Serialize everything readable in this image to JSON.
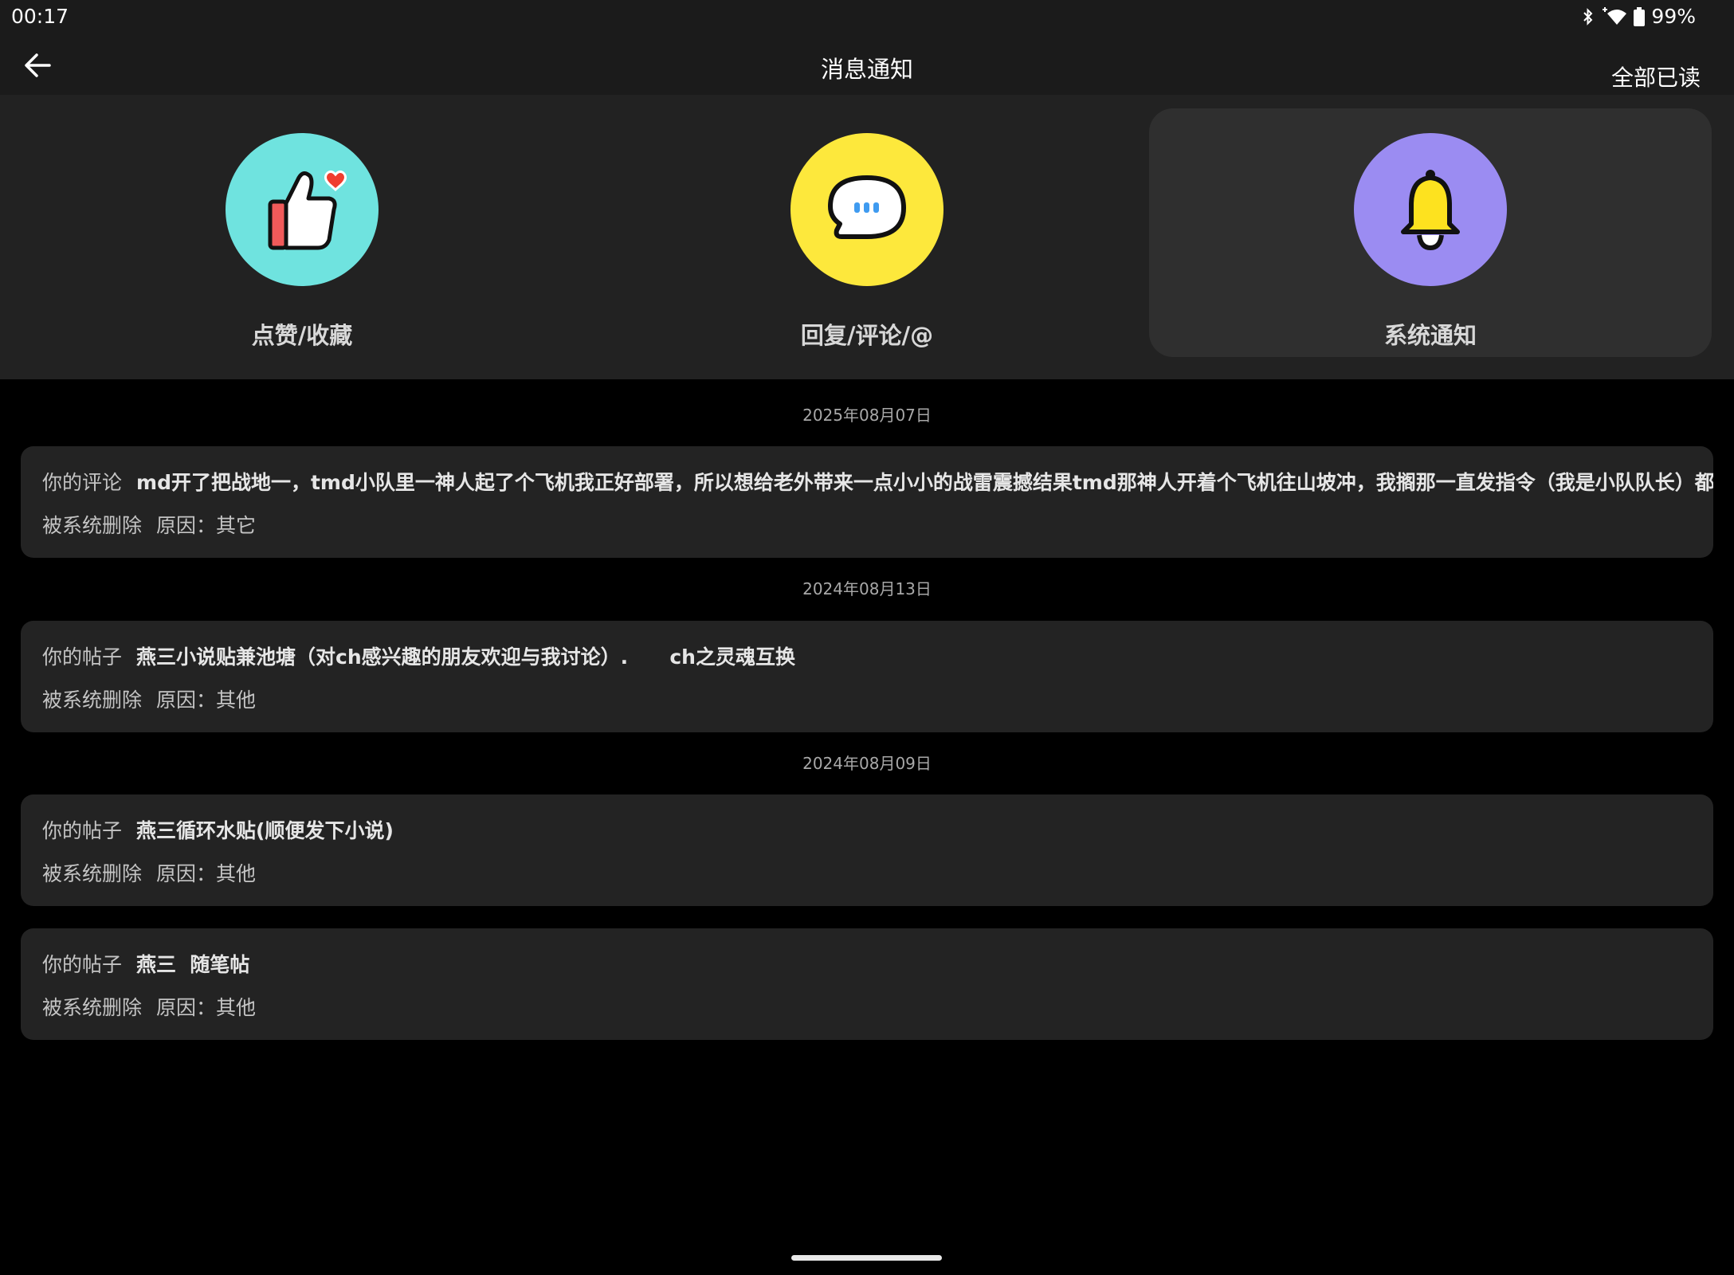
{
  "status": {
    "time": "00:17",
    "battery": "99%"
  },
  "header": {
    "title": "消息通知",
    "mark_all_read": "全部已读"
  },
  "categories": [
    {
      "label": "点赞/收藏",
      "icon": "thumbs-up-heart-icon",
      "color": "#6fe3df"
    },
    {
      "label": "回复/评论/@",
      "icon": "chat-bubble-icon",
      "color": "#fde83c"
    },
    {
      "label": "系统通知",
      "icon": "bell-icon",
      "color": "#9b8cf2",
      "active": true
    }
  ],
  "notifications": [
    {
      "date": "2025年08月07日",
      "items": [
        {
          "prefix": "你的评论",
          "target": "md开了把战地一，tmd小队里一神人起了个飞机我正好部署，所以想给老外带来一点小小的战雷震撼结果tmd那神人开着个飞机往山坡冲，我搁那一直发指令（我是小队队长）都没用，最",
          "status": "被系统删除",
          "reason": "原因：其它"
        }
      ]
    },
    {
      "date": "2024年08月13日",
      "items": [
        {
          "prefix": "你的帖子",
          "target": "燕三小说贴兼池塘（对ch感兴趣的朋友欢迎与我讨论）.      ch之灵魂互换",
          "status": "被系统删除",
          "reason": "原因：其他"
        }
      ]
    },
    {
      "date": "2024年08月09日",
      "items": [
        {
          "prefix": "你的帖子",
          "target": "燕三循环水贴(顺便发下小说)",
          "status": "被系统删除",
          "reason": "原因：其他"
        },
        {
          "prefix": "你的帖子",
          "target": "燕三  随笔帖",
          "status": "被系统删除",
          "reason": "原因：其他"
        }
      ]
    }
  ]
}
